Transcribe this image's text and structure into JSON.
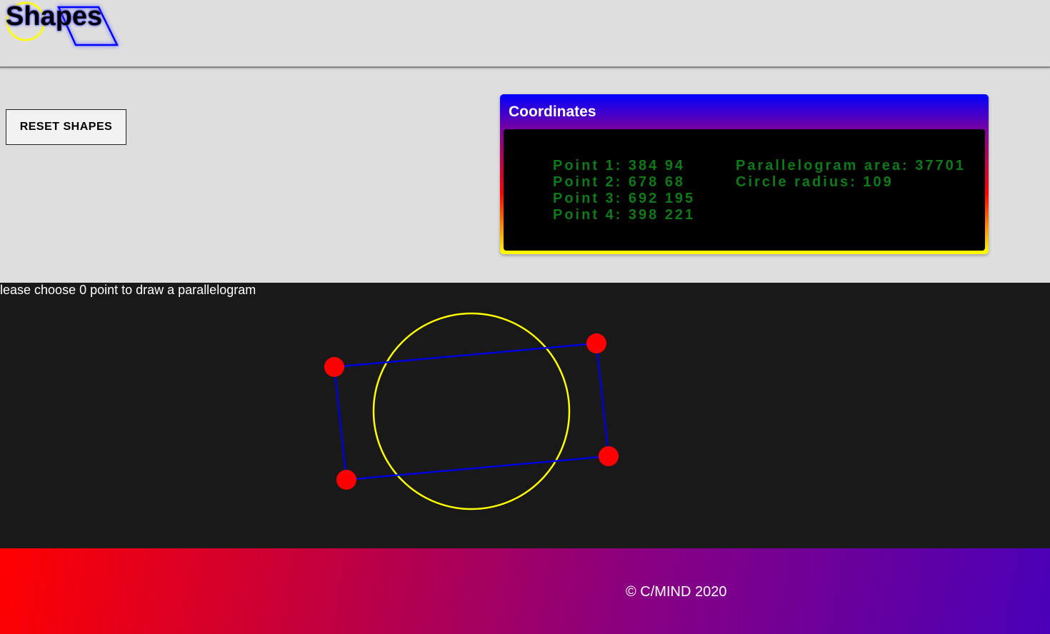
{
  "header": {
    "logo_text": "Shapes"
  },
  "controls": {
    "reset_label": "RESET SHAPES"
  },
  "coordinates": {
    "title": "Coordinates",
    "points": [
      "Point 1: 384 94",
      "Point 2: 678 68",
      "Point 3: 692 195",
      "Point 4: 398 221"
    ],
    "area_text": "Parallelogram area: 37701",
    "radius_text": "Circle radius: 109"
  },
  "canvas": {
    "message": "lease choose 0 point to draw a parallelogram",
    "point_color": "#ff0000",
    "parallelogram_color": "#0000dd",
    "circle_color": "#ffff00",
    "background_color": "#191919"
  },
  "footer": {
    "text": "© C/MIND 2020"
  }
}
